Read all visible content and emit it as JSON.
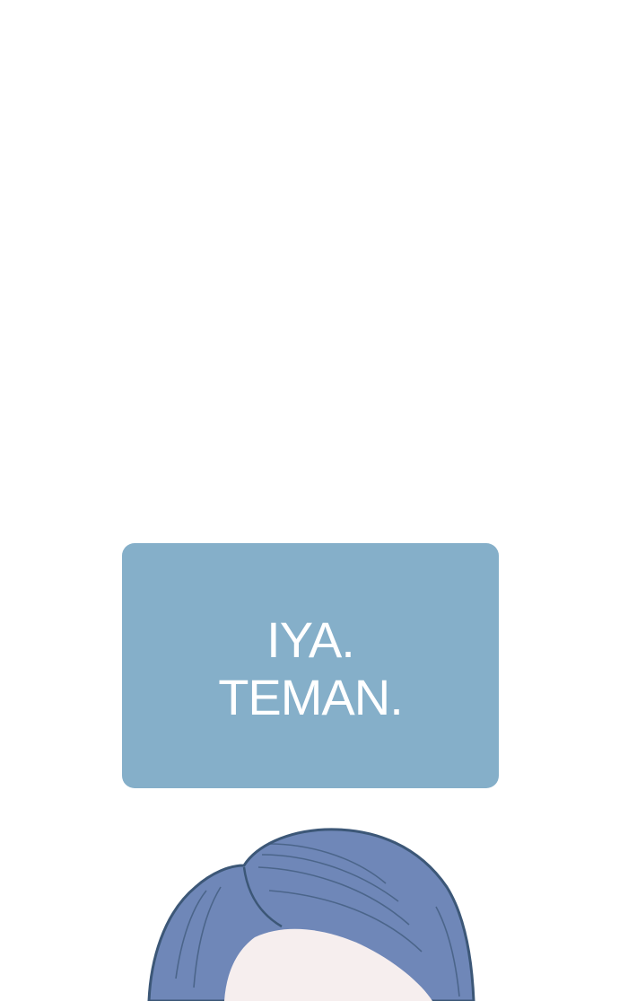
{
  "caption": {
    "lines": [
      "IYA.",
      "TEMAN."
    ],
    "background_color": "#85afc9",
    "text_color": "#ffffff"
  },
  "figure": {
    "subject": "character-head-top",
    "hair_color": "#6f87b8",
    "hair_outline_color": "#3c5777",
    "skin_color": "#f6eeee"
  }
}
